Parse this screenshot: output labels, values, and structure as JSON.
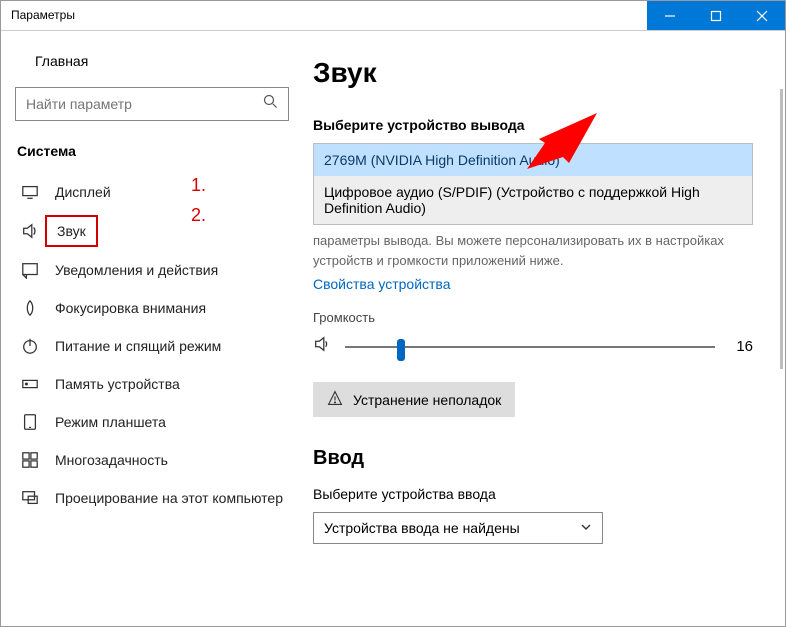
{
  "window": {
    "title": "Параметры"
  },
  "sidebar": {
    "home": "Главная",
    "search_placeholder": "Найти параметр",
    "group": "Система",
    "items": [
      "Дисплей",
      "Звук",
      "Уведомления и действия",
      "Фокусировка внимания",
      "Питание и спящий режим",
      "Память устройства",
      "Режим планшета",
      "Многозадачность",
      "Проецирование на этот компьютер"
    ],
    "active_index": 1
  },
  "content": {
    "heading": "Звук",
    "output_label": "Выберите устройство вывода",
    "dropdown": {
      "options": [
        "2769M (NVIDIA High Definition Audio)",
        "Цифровое аудио (S/PDIF) (Устройство с поддержкой High Definition Audio)"
      ]
    },
    "hint": "параметры вывода. Вы можете персонализировать их в настройках устройств и громкости приложений ниже.",
    "device_props_link": "Свойства устройства",
    "volume_label": "Громкость",
    "volume_value": "16",
    "troubleshoot": "Устранение неполадок",
    "input_heading": "Ввод",
    "input_label": "Выберите устройства ввода",
    "input_dropdown_value": "Устройства ввода не найдены"
  },
  "annotations": {
    "one": "1.",
    "two": "2."
  }
}
